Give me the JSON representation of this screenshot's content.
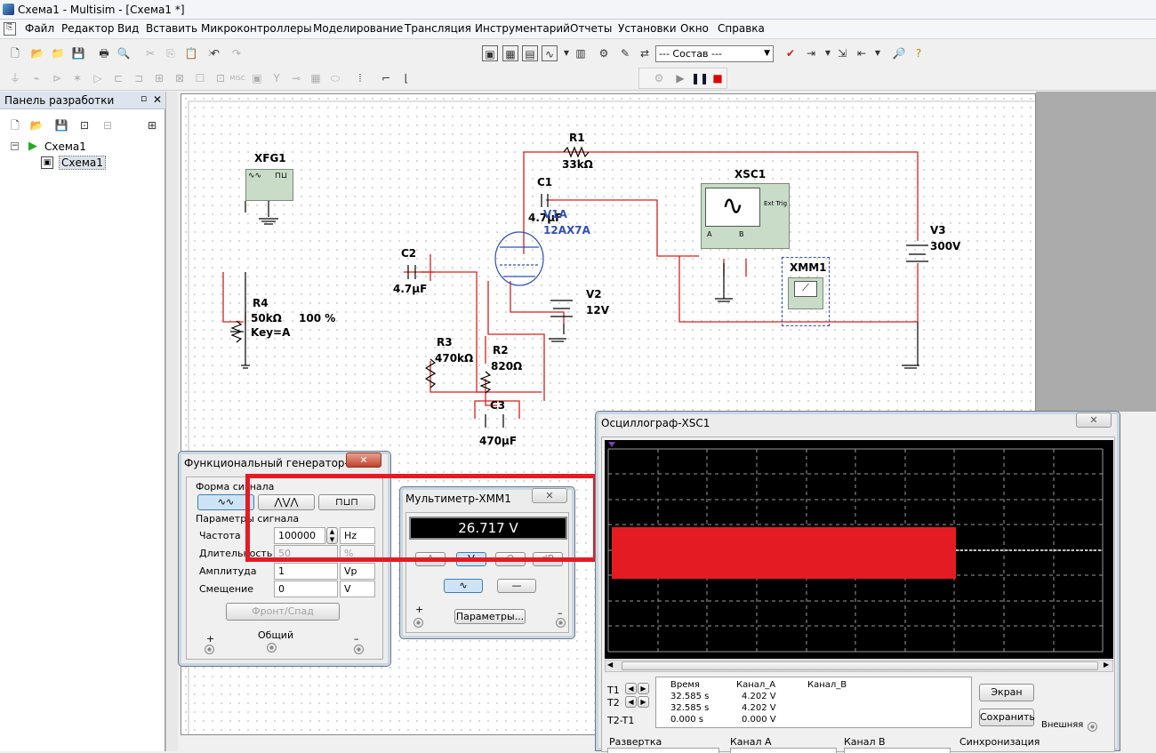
{
  "window": {
    "title": "Схема1 - Multisim - [Схема1 *]"
  },
  "menu": [
    "Файл",
    "Редактор",
    "Вид",
    "Вставить",
    "Микроконтроллеры",
    "Моделирование",
    "Трансляция",
    "Инструментарий",
    "Отчеты",
    "Установки",
    "Окно",
    "Справка"
  ],
  "toolbar": {
    "components_select": "--- Состав ---"
  },
  "design_panel": {
    "title": "Панель разработки",
    "tree_root": "Схема1",
    "tree_child": "Схема1"
  },
  "schematic": {
    "xfg1": "XFG1",
    "r1": "R1",
    "r1_val": "33kΩ",
    "c1": "C1",
    "c1_val": "4.7μF",
    "tube": "V1A",
    "tube_val": "12AX7A",
    "xsc1": "XSC1",
    "ext_trig": "Ext Trig",
    "ch_a": "A",
    "ch_b": "B",
    "v3": "V3",
    "v3_val": "300V",
    "c2": "C2",
    "c2_val": "4.7μF",
    "xmm1": "XMM1",
    "v2": "V2",
    "v2_val": "12V",
    "r4": "R4",
    "r4_val": "50kΩ",
    "r4_key": "Key=A",
    "r4_pct": "100 %",
    "r3": "R3",
    "r3_val": "470kΩ",
    "r2": "R2",
    "r2_val": "820Ω",
    "c3": "C3",
    "c3_val": "470μF"
  },
  "func_gen": {
    "title": "Функциональный генератор-...",
    "waveform_group": "Форма сигнала",
    "params_group": "Параметры сигнала",
    "frequency_label": "Частота",
    "frequency_value": "100000",
    "frequency_unit": "Hz",
    "duty_label": "Длительность",
    "duty_value": "50",
    "duty_unit": "%",
    "amplitude_label": "Амплитуда",
    "amplitude_value": "1",
    "amplitude_unit": "Vp",
    "offset_label": "Смещение",
    "offset_value": "0",
    "offset_unit": "V",
    "rise_fall_button": "Фронт/Спад",
    "plus": "+",
    "common": "Общий",
    "minus": "–"
  },
  "multimeter": {
    "title": "Мультиметр-XMM1",
    "reading": "26.717 V",
    "btn_a": "A",
    "btn_v": "V",
    "btn_ohm": "Ω",
    "btn_db": "dB",
    "params_button": "Параметры...",
    "plus": "+",
    "minus": "–"
  },
  "scope": {
    "title": "Осциллограф-XSC1",
    "t1": "T1",
    "t2": "T2",
    "t2t1": "T2-T1",
    "col_time": "Время",
    "col_cha": "Канал_А",
    "col_chb": "Канал_В",
    "t1_time": "32.585 s",
    "t1_cha": "4.202 V",
    "t2_time": "32.585 s",
    "t2_cha": "4.202 V",
    "d_time": "0.000 s",
    "d_cha": "0.000 V",
    "screen_button": "Экран",
    "save_button": "Сохранить",
    "external_label": "Внешняя",
    "timebase_label": "Развертка",
    "cha_label": "Канал A",
    "chb_label": "Канал B",
    "sync_label": "Синхронизация"
  },
  "colors": {
    "wire": "#d42020",
    "highlight": "#e51b24",
    "scope_bg": "#000000",
    "instrument_green": "#c8dcc8"
  }
}
